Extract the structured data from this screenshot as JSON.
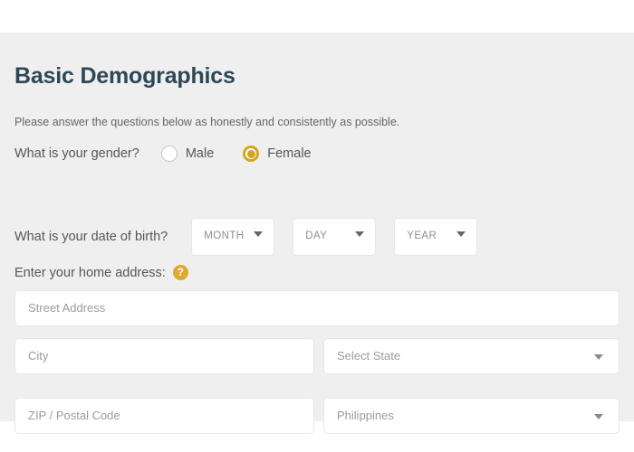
{
  "form": {
    "title": "Basic Demographics",
    "subtitle": "Please answer the questions below as honestly and consistently as possible.",
    "accent_color": "#d3a51f",
    "title_color": "#2e4756",
    "panel_color": "#efefef"
  },
  "gender": {
    "question": "What is your gender?",
    "options": [
      {
        "label": "Male",
        "selected": false
      },
      {
        "label": "Female",
        "selected": true
      }
    ]
  },
  "date_of_birth": {
    "question": "What is your date of birth?",
    "selects": [
      {
        "name": "month",
        "value": "MONTH"
      },
      {
        "name": "day",
        "value": "DAY"
      },
      {
        "name": "year",
        "value": "YEAR"
      }
    ],
    "caret_icon": "chevron-down-icon"
  },
  "address": {
    "question": "Enter your home address:",
    "help_icon": "question-mark-icon",
    "help_icon_glyph": "?",
    "fields": {
      "street": {
        "placeholder": "Street Address",
        "value": ""
      },
      "city": {
        "placeholder": "City",
        "value": ""
      },
      "state": {
        "placeholder": "Select State",
        "value": ""
      },
      "zip": {
        "placeholder": "ZIP / Postal Code",
        "value": ""
      },
      "country": {
        "placeholder": "Philippines",
        "value": "Philippines"
      }
    }
  }
}
